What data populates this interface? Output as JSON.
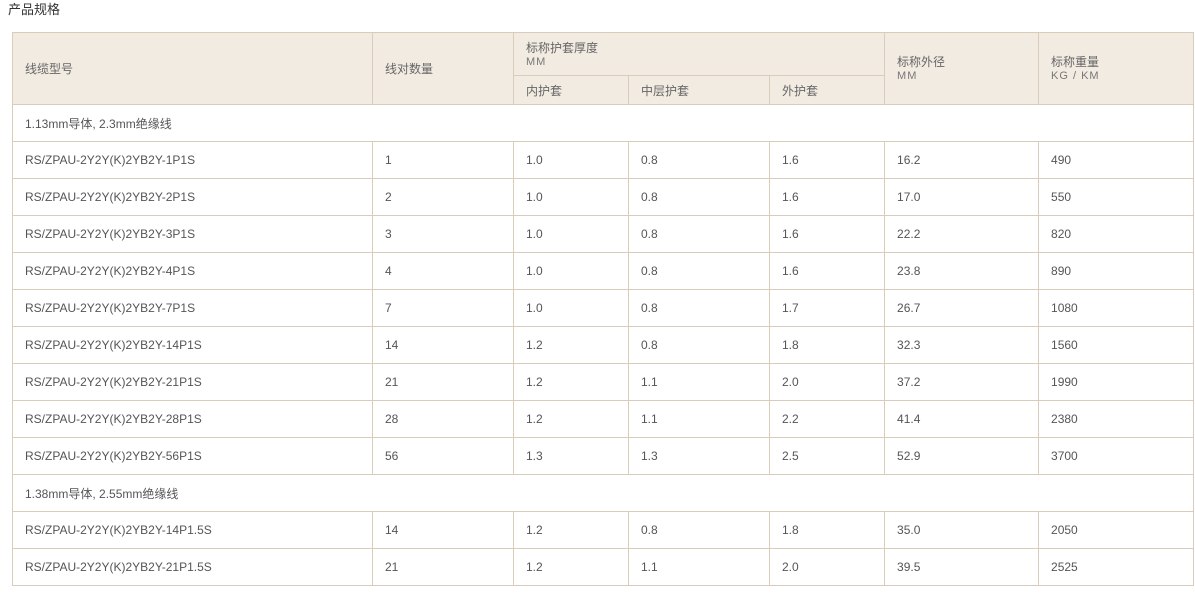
{
  "title": "产品规格",
  "header": {
    "model": "线缆型号",
    "pairs": "线对数量",
    "sheath_group": {
      "label": "标称护套厚度",
      "unit": "MM"
    },
    "inner": "内护套",
    "middle": "中层护套",
    "outer": "外护套",
    "diameter": {
      "label": "标称外径",
      "unit": "MM"
    },
    "weight": {
      "label": "标称重量",
      "unit": "KG / KM"
    }
  },
  "sections": [
    {
      "label": "1.13mm导体, 2.3mm绝缘线",
      "rows": [
        [
          "RS/ZPAU-2Y2Y(K)2YB2Y-1P1S",
          "1",
          "1.0",
          "0.8",
          "1.6",
          "16.2",
          "490"
        ],
        [
          "RS/ZPAU-2Y2Y(K)2YB2Y-2P1S",
          "2",
          "1.0",
          "0.8",
          "1.6",
          "17.0",
          "550"
        ],
        [
          "RS/ZPAU-2Y2Y(K)2YB2Y-3P1S",
          "3",
          "1.0",
          "0.8",
          "1.6",
          "22.2",
          "820"
        ],
        [
          "RS/ZPAU-2Y2Y(K)2YB2Y-4P1S",
          "4",
          "1.0",
          "0.8",
          "1.6",
          "23.8",
          "890"
        ],
        [
          "RS/ZPAU-2Y2Y(K)2YB2Y-7P1S",
          "7",
          "1.0",
          "0.8",
          "1.7",
          "26.7",
          "1080"
        ],
        [
          "RS/ZPAU-2Y2Y(K)2YB2Y-14P1S",
          "14",
          "1.2",
          "0.8",
          "1.8",
          "32.3",
          "1560"
        ],
        [
          "RS/ZPAU-2Y2Y(K)2YB2Y-21P1S",
          "21",
          "1.2",
          "1.1",
          "2.0",
          "37.2",
          "1990"
        ],
        [
          "RS/ZPAU-2Y2Y(K)2YB2Y-28P1S",
          "28",
          "1.2",
          "1.1",
          "2.2",
          "41.4",
          "2380"
        ],
        [
          "RS/ZPAU-2Y2Y(K)2YB2Y-56P1S",
          "56",
          "1.3",
          "1.3",
          "2.5",
          "52.9",
          "3700"
        ]
      ]
    },
    {
      "label": "1.38mm导体, 2.55mm绝缘线",
      "rows": [
        [
          "RS/ZPAU-2Y2Y(K)2YB2Y-14P1.5S",
          "14",
          "1.2",
          "0.8",
          "1.8",
          "35.0",
          "2050"
        ],
        [
          "RS/ZPAU-2Y2Y(K)2YB2Y-21P1.5S",
          "21",
          "1.2",
          "1.1",
          "2.0",
          "39.5",
          "2525"
        ]
      ]
    }
  ]
}
